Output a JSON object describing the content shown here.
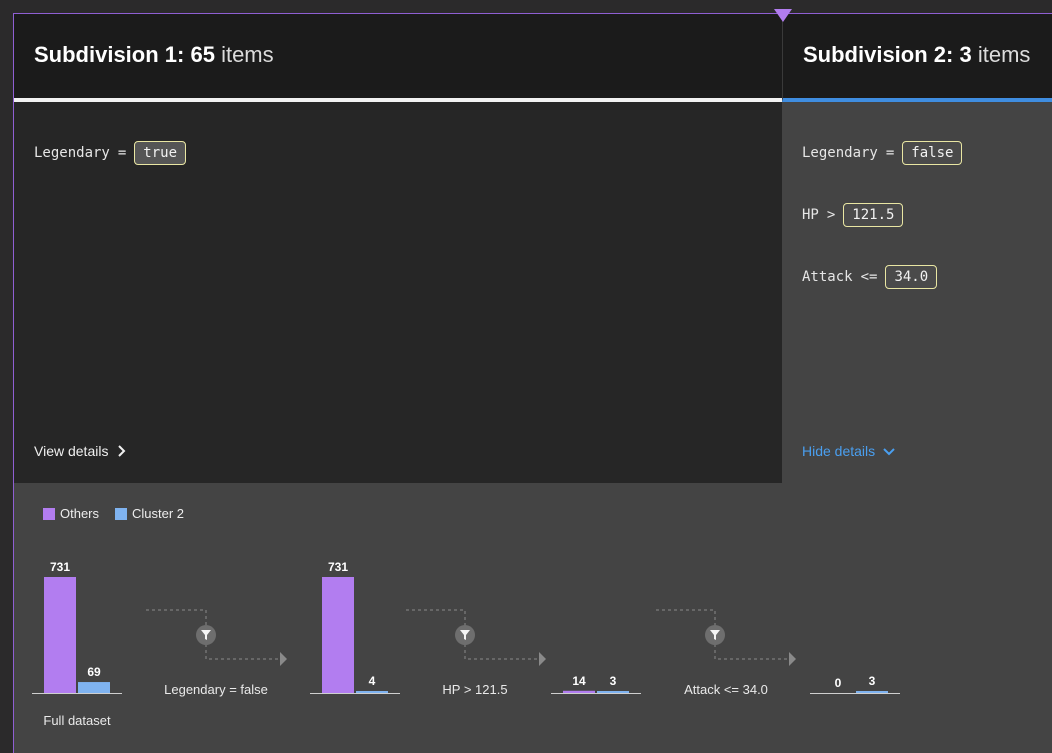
{
  "marker_color": "#b27df0",
  "subdivision1": {
    "title_bold": "Subdivision 1: 65",
    "title_light": "items",
    "conditions": [
      {
        "field": "Legendary",
        "op": "=",
        "value": "true"
      }
    ],
    "details_label": "View details",
    "details_icon": "chevron-right-icon"
  },
  "subdivision2": {
    "title_bold": "Subdivision 2: 3",
    "title_light": "items",
    "conditions": [
      {
        "field": "Legendary",
        "op": "=",
        "value": "false"
      },
      {
        "field": "HP",
        "op": ">",
        "value": "121.5"
      },
      {
        "field": "Attack",
        "op": "<=",
        "value": "34.0"
      }
    ],
    "details_label": "Hide details",
    "details_icon": "chevron-down-icon"
  },
  "legend": [
    {
      "name": "Others",
      "color": "#b27df0"
    },
    {
      "name": "Cluster 2",
      "color": "#7fb3f0"
    }
  ],
  "chart_data": {
    "type": "bar",
    "steps": [
      {
        "others": 731,
        "cluster": 69,
        "caption": "Full dataset"
      },
      {
        "others": 731,
        "cluster": 4,
        "caption": ""
      },
      {
        "others": 14,
        "cluster": 3,
        "caption": ""
      },
      {
        "others": 0,
        "cluster": 3,
        "caption": ""
      }
    ],
    "filters": [
      "Legendary = false",
      "HP > 121.5",
      "Attack <= 34.0"
    ],
    "series": [
      {
        "name": "Others",
        "color": "#b27df0"
      },
      {
        "name": "Cluster 2",
        "color": "#7fb3f0"
      }
    ],
    "max": 731
  }
}
